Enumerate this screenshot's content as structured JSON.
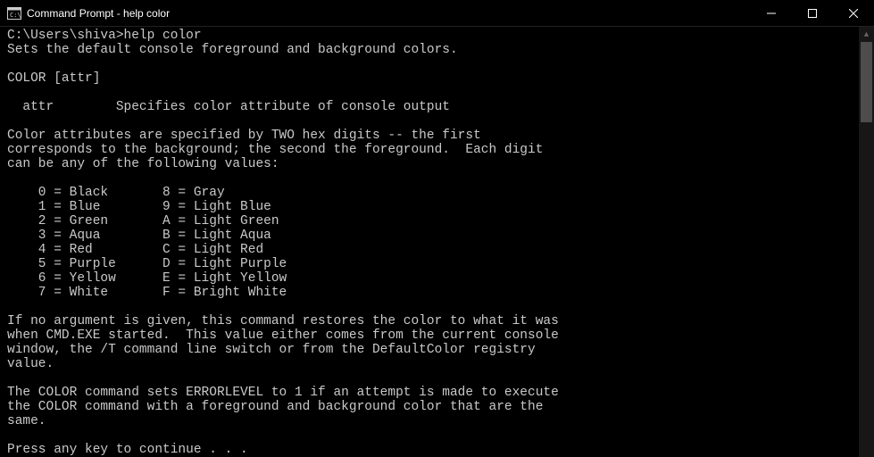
{
  "titlebar": {
    "title": "Command Prompt - help  color"
  },
  "terminal": {
    "prompt": "C:\\Users\\shiva>",
    "command": "help color",
    "line_desc": "Sets the default console foreground and background colors.",
    "usage": "COLOR [attr]",
    "attr_line": "  attr        Specifies color attribute of console output",
    "para1_l1": "Color attributes are specified by TWO hex digits -- the first",
    "para1_l2": "corresponds to the background; the second the foreground.  Each digit",
    "para1_l3": "can be any of the following values:",
    "tbl_l1": "    0 = Black       8 = Gray",
    "tbl_l2": "    1 = Blue        9 = Light Blue",
    "tbl_l3": "    2 = Green       A = Light Green",
    "tbl_l4": "    3 = Aqua        B = Light Aqua",
    "tbl_l5": "    4 = Red         C = Light Red",
    "tbl_l6": "    5 = Purple      D = Light Purple",
    "tbl_l7": "    6 = Yellow      E = Light Yellow",
    "tbl_l8": "    7 = White       F = Bright White",
    "para2_l1": "If no argument is given, this command restores the color to what it was",
    "para2_l2": "when CMD.EXE started.  This value either comes from the current console",
    "para2_l3": "window, the /T command line switch or from the DefaultColor registry",
    "para2_l4": "value.",
    "para3_l1": "The COLOR command sets ERRORLEVEL to 1 if an attempt is made to execute",
    "para3_l2": "the COLOR command with a foreground and background color that are the",
    "para3_l3": "same.",
    "press_key": "Press any key to continue . . ."
  }
}
